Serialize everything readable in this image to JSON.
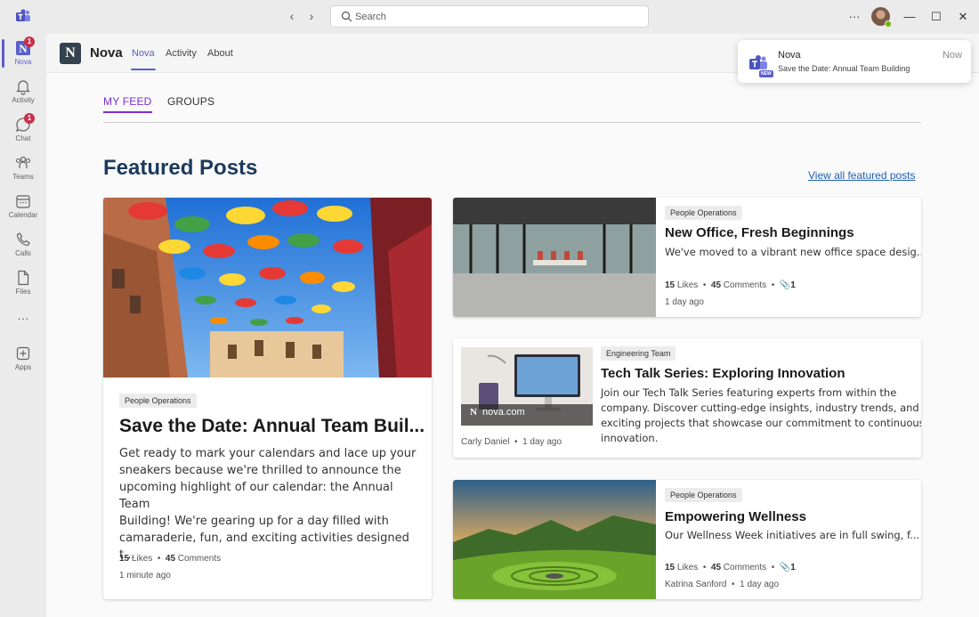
{
  "window": {
    "search_placeholder": "Search",
    "more_label": "···",
    "minimize_label": "—",
    "maximize_label": "☐",
    "close_label": "✕"
  },
  "rail": {
    "items": [
      {
        "label": "Nova",
        "badge": "1"
      },
      {
        "label": "Activity"
      },
      {
        "label": "Chat",
        "badge": "1"
      },
      {
        "label": "Teams"
      },
      {
        "label": "Calendar"
      },
      {
        "label": "Calls"
      },
      {
        "label": "Files"
      },
      {
        "label": "···"
      },
      {
        "label": "Apps"
      }
    ]
  },
  "app": {
    "logo_letter": "N",
    "name": "Nova",
    "tabs": [
      {
        "label": "Nova",
        "active": true
      },
      {
        "label": "Activity"
      },
      {
        "label": "About"
      }
    ]
  },
  "feed": {
    "tabs": [
      {
        "label": "MY FEED",
        "active": true
      },
      {
        "label": "GROUPS"
      }
    ],
    "section_title": "Featured Posts",
    "view_all": "View all featured posts"
  },
  "posts": {
    "main": {
      "tag": "People Operations",
      "title": "Save the Date: Annual Team Buil...",
      "excerpt_lines": [
        "Get ready to mark your calendars and lace up your",
        "sneakers because we're thrilled to announce the",
        "upcoming highlight of our calendar: the Annual Team",
        "Building! We're gearing up for a day filled with",
        "camaraderie, fun, and exciting activities designed t..."
      ],
      "likes": "15",
      "likes_label": "Likes",
      "comments": "45",
      "comments_label": "Comments",
      "time": "1 minute ago"
    },
    "office": {
      "tag": "People Operations",
      "title": "New Office, Fresh Beginnings",
      "excerpt": "We've moved to a vibrant new office space desig...",
      "likes": "15",
      "likes_label": "Likes",
      "comments": "45",
      "comments_label": "Comments",
      "attachments": "1",
      "time": "1 day ago"
    },
    "techtalk": {
      "tag": "Engineering Team",
      "title": "Tech Talk Series: Exploring Innovation",
      "excerpt_lines": [
        "Join our Tech Talk Series featuring experts from within the",
        "company. Discover cutting-edge insights, industry trends, and",
        "exciting projects that showcase our commitment to continuous",
        "innovation."
      ],
      "link_label": "nova.com",
      "author": "Carly Daniel",
      "time": "1 day ago"
    },
    "wellness": {
      "tag": "People Operations",
      "title": "Empowering Wellness",
      "excerpt": "Our Wellness Week initiatives are in full swing, f...",
      "likes": "15",
      "likes_label": "Likes",
      "comments": "45",
      "comments_label": "Comments",
      "attachments": "1",
      "author": "Katrina Sanford",
      "time": "1 day ago"
    }
  },
  "toast": {
    "app": "Nova",
    "badge": "NEW",
    "message": "Save the Date: Annual Team Building",
    "time": "Now"
  },
  "colors": {
    "accent": "#5b5fc7",
    "feed_accent": "#7a2fd6",
    "title_navy": "#1b3a5c",
    "link_blue": "#1e5fb3",
    "badge_red": "#c4314b"
  }
}
